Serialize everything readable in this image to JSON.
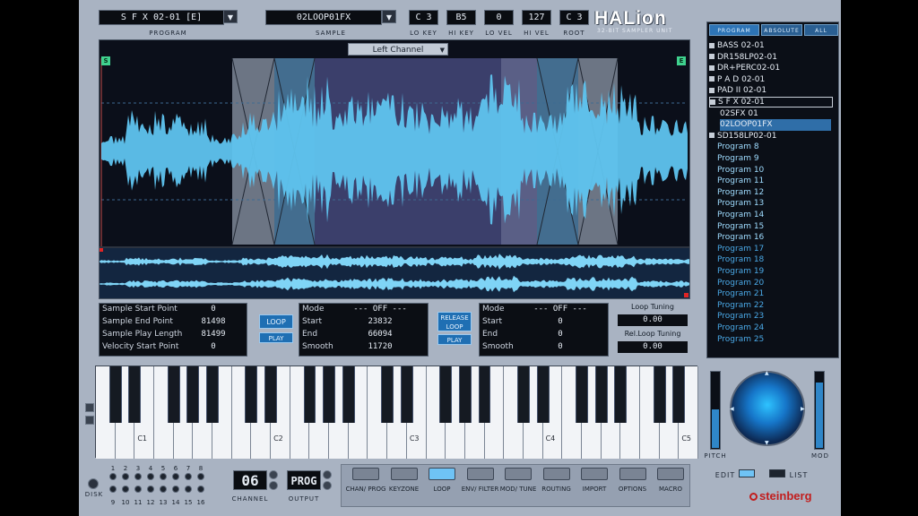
{
  "app": {
    "logo": "HALion",
    "subtitle": "32-BIT SAMPLER UNIT"
  },
  "header": {
    "program": {
      "value": "S F X 02-01 [E]",
      "label": "PROGRAM"
    },
    "sample": {
      "value": "02LOOP01FX",
      "label": "SAMPLE"
    },
    "params": [
      {
        "value": "C 3",
        "label": "LO KEY"
      },
      {
        "value": "B5",
        "label": "HI KEY"
      },
      {
        "value": "0",
        "label": "LO VEL"
      },
      {
        "value": "127",
        "label": "HI VEL"
      },
      {
        "value": "C 3",
        "label": "ROOT"
      }
    ]
  },
  "wave": {
    "channel": "Left Channel",
    "start_flag": "S",
    "end_flag": "E"
  },
  "sample_panel": {
    "rows": [
      {
        "label": "Sample Start Point",
        "value": "0"
      },
      {
        "label": "Sample End Point",
        "value": "81498"
      },
      {
        "label": "Sample Play Length",
        "value": "81499"
      },
      {
        "label": "Velocity Start Point",
        "value": "0"
      }
    ]
  },
  "loop_btn": "LOOP",
  "play_btn": "PLAY",
  "sustain_loop": {
    "mode_label": "Mode",
    "mode": "--- OFF ---",
    "rows": [
      {
        "label": "Start",
        "value": "23832"
      },
      {
        "label": "End",
        "value": "66094"
      },
      {
        "label": "Smooth",
        "value": "11720"
      }
    ]
  },
  "release_loop_btn": "RELEASE LOOP",
  "release_play_btn": "PLAY",
  "release_loop": {
    "mode_label": "Mode",
    "mode": "--- OFF ---",
    "rows": [
      {
        "label": "Start",
        "value": "0"
      },
      {
        "label": "End",
        "value": "0"
      },
      {
        "label": "Smooth",
        "value": "0"
      }
    ]
  },
  "tuning": {
    "loop_label": "Loop Tuning",
    "loop_value": "0.00",
    "rel_label": "Rel.Loop Tuning",
    "rel_value": "0.00"
  },
  "browser": {
    "tabs": [
      "PROGRAM",
      "ABSOLUTE",
      "ALL"
    ],
    "items": [
      {
        "label": "BASS   02-01",
        "type": "box"
      },
      {
        "label": "DR158LP02-01",
        "type": "box"
      },
      {
        "label": "DR+PERC02-01",
        "type": "box"
      },
      {
        "label": "P A D  02-01",
        "type": "box"
      },
      {
        "label": "PAD II 02-01",
        "type": "box"
      },
      {
        "label": "S F X  02-01",
        "type": "open"
      },
      {
        "label": "02SFX 01",
        "type": "child"
      },
      {
        "label": "02LOOP01FX",
        "type": "child-sel"
      },
      {
        "label": "SD158LP02-01",
        "type": "box"
      },
      {
        "label": "Program 8",
        "type": "prog"
      },
      {
        "label": "Program 9",
        "type": "prog"
      },
      {
        "label": "Program 10",
        "type": "prog"
      },
      {
        "label": "Program 11",
        "type": "prog"
      },
      {
        "label": "Program 12",
        "type": "prog"
      },
      {
        "label": "Program 13",
        "type": "prog"
      },
      {
        "label": "Program 14",
        "type": "prog"
      },
      {
        "label": "Program 15",
        "type": "prog"
      },
      {
        "label": "Program 16",
        "type": "prog"
      },
      {
        "label": "Program 17",
        "type": "prog2"
      },
      {
        "label": "Program 18",
        "type": "prog2"
      },
      {
        "label": "Program 19",
        "type": "prog2"
      },
      {
        "label": "Program 20",
        "type": "prog2"
      },
      {
        "label": "Program 21",
        "type": "prog2"
      },
      {
        "label": "Program 22",
        "type": "prog2"
      },
      {
        "label": "Program 23",
        "type": "prog2"
      },
      {
        "label": "Program 24",
        "type": "prog2"
      },
      {
        "label": "Program 25",
        "type": "prog2"
      }
    ]
  },
  "keyboard": {
    "octave_labels": [
      "C1",
      "C2",
      "C3",
      "C4",
      "C5"
    ]
  },
  "controls": {
    "pitch": "PITCH",
    "mod": "MOD",
    "pitch_level": 0.5,
    "mod_level": 0.85
  },
  "bottom": {
    "channel_value": "06",
    "channel_label": "CHANNEL",
    "output_value": "PROG",
    "output_label": "OUTPUT",
    "disk_label": "DISK",
    "midi_top": [
      "1",
      "2",
      "3",
      "4",
      "5",
      "6",
      "7",
      "8"
    ],
    "midi_bottom": [
      "9",
      "10",
      "11",
      "12",
      "13",
      "14",
      "15",
      "16"
    ],
    "functions": [
      "CHAN/ PROG",
      "KEYZONE",
      "LOOP",
      "ENV/ FILTER",
      "MOD/ TUNE",
      "ROUTING",
      "IMPORT",
      "OPTIONS",
      "MACRO"
    ],
    "edit": "EDIT",
    "list": "LIST",
    "brand": "steinberg"
  }
}
